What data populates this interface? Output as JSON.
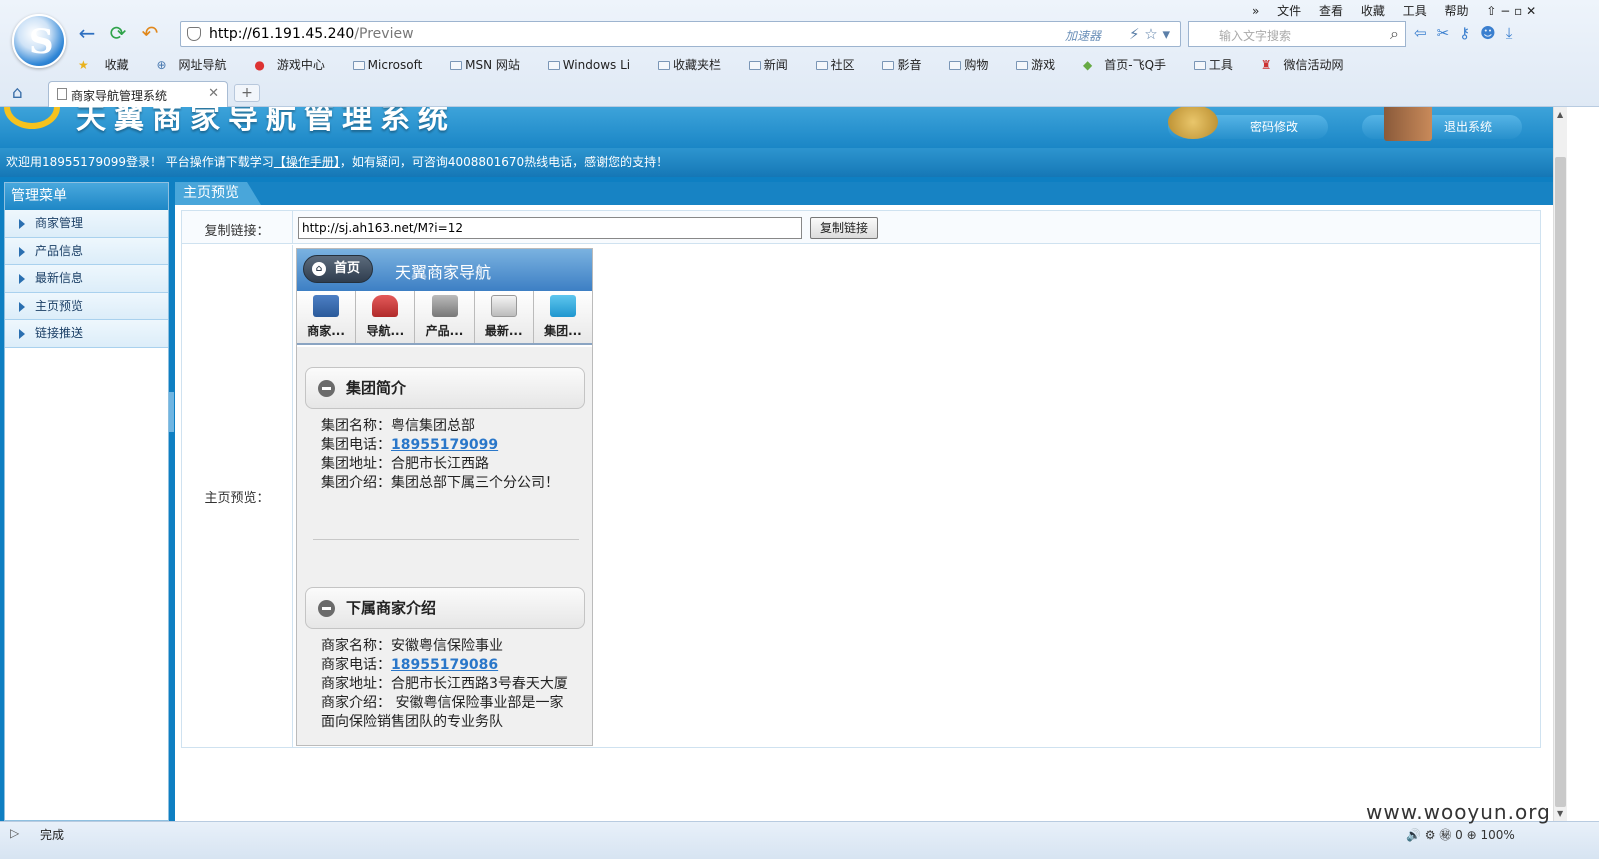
{
  "browser": {
    "url_host": "http://61.191.45.240",
    "url_path": "/Preview",
    "accelerator": "加速器",
    "search_placeholder": "输入文字搜索",
    "menu": [
      "文件",
      "查看",
      "收藏",
      "工具",
      "帮助"
    ],
    "bookmarks": [
      "收藏",
      "网址导航",
      "游戏中心",
      "Microsoft",
      "MSN 网站",
      "Windows Li",
      "收藏夹栏",
      "新闻",
      "社区",
      "影音",
      "购物",
      "游戏",
      "首页-飞Q手",
      "工具",
      "微信活动网"
    ],
    "tab_title": "商家导航管理系统",
    "status_text": "完成",
    "status_right": "🔊  ⚙  ㊙ 0  ⊕ 100%"
  },
  "app": {
    "banner_title": "天翼商家导航管理系统",
    "password_button": "密码修改",
    "exit_button": "退出系统",
    "welcome_prefix": "欢迎用18955179099登录！ 平台操作请下载学习",
    "welcome_link": "【操作手册】",
    "welcome_suffix": "，如有疑问，可咨询4008801670热线电话，感谢您的支持！",
    "sidebar_title": "管理菜单",
    "sidebar_items": [
      "商家管理",
      "产品信息",
      "最新信息",
      "主页预览",
      "链接推送"
    ],
    "main_tab": "主页预览",
    "copy_link_label": "复制链接：",
    "copy_link_value": "http://sj.ah163.net/M?i=12",
    "copy_button": "复制链接",
    "preview_label": "主页预览："
  },
  "preview": {
    "home_button": "首页",
    "title": "天翼商家导航",
    "nav": [
      "商家...",
      "导航...",
      "产品...",
      "最新...",
      "集团..."
    ],
    "group_header": "集团简介",
    "group": {
      "name": "集团名称：粤信集团总部",
      "phone_label": "集团电话：",
      "phone": "18955179099",
      "address": "集团地址：合肥市长江西路",
      "intro": "集团介绍：集团总部下属三个分公司！"
    },
    "merchant_header": "下属商家介绍",
    "merchant": {
      "name": "商家名称：安徽粤信保险事业",
      "phone_label": "商家电话：",
      "phone": "18955179086",
      "address": "商家地址：合肥市长江西路3号春天大厦",
      "intro": "商家介绍： 安徽粤信保险事业部是一家面向保险销售团队的专业务队"
    }
  },
  "watermark": "www.wooyun.org"
}
